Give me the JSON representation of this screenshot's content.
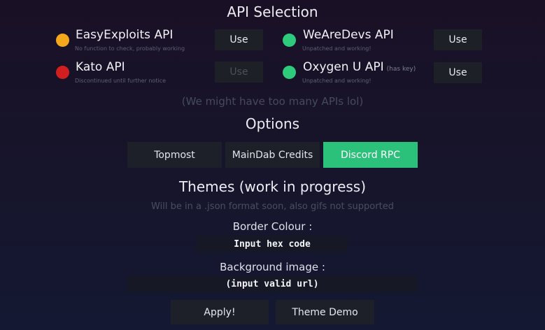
{
  "api_selection": {
    "title": "API Selection",
    "apis": [
      {
        "name": "EasyExploits API",
        "status": "No function to check, probably working",
        "use_label": "Use",
        "dot_color": "#f4a81c"
      },
      {
        "name": "WeAreDevs API",
        "status": "Unpatched and working!",
        "use_label": "Use",
        "dot_color": "#2ecb7d"
      },
      {
        "name": "Kato API",
        "status": "Discontinued until further notice",
        "use_label": "Use",
        "dot_color": "#d11f1f"
      },
      {
        "name": "Oxygen U API",
        "tag": "(has key)",
        "status": "Unpatched and working!",
        "use_label": "Use",
        "dot_color": "#2ecb7d"
      }
    ],
    "note": "(We might have too many APIs lol)"
  },
  "options": {
    "title": "Options",
    "buttons": [
      {
        "label": "Topmost",
        "active": false
      },
      {
        "label": "MainDab Credits",
        "active": false
      },
      {
        "label": "Discord RPC",
        "active": true
      }
    ]
  },
  "themes": {
    "title": "Themes (work in progress)",
    "subtitle": "Will be in a .json format soon, also gifs not supported",
    "border_label": "Border Colour :",
    "border_placeholder": "Input hex code",
    "background_label": "Background image :",
    "background_placeholder": "(input valid url)",
    "apply_label": "Apply!",
    "demo_label": "Theme Demo"
  },
  "colors": {
    "accent": "#2cc17b",
    "warning": "#f4a81c",
    "error": "#d11f1f",
    "success": "#2ecb7d"
  }
}
